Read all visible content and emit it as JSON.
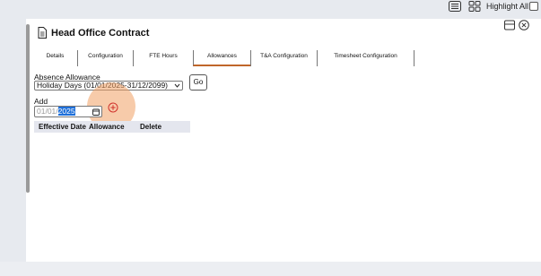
{
  "toolbar": {
    "list_icon": "list-icon",
    "grid_icon": "grid-icon",
    "highlight_label": "Highlight All"
  },
  "panel": {
    "title": "Head Office Contract",
    "title_icon": "document-icon",
    "window_icon": "window-icon",
    "close_icon": "close-icon"
  },
  "tabs": [
    {
      "label": "Details"
    },
    {
      "label": "Configuration"
    },
    {
      "label": "FTE Hours"
    },
    {
      "label": "Allowances",
      "active": true
    },
    {
      "label": "T&A Configuration"
    },
    {
      "label": "Timesheet Configuration"
    }
  ],
  "absence": {
    "label": "Absence Allowance",
    "selected": "Holiday Days (01/01/2025-31/12/2099)",
    "go_label": "Go"
  },
  "add": {
    "label": "Add",
    "date_faint": "01/01/",
    "date_selected": "2025",
    "add_icon": "plus-circle-icon",
    "calendar_icon": "calendar-icon"
  },
  "table": {
    "columns": [
      "Effective Date",
      "Allowance",
      "Delete"
    ]
  },
  "colors": {
    "active_tab_underline": "#c0662a",
    "highlight_circle": "#f0a064",
    "selection": "#1e6fd9"
  }
}
